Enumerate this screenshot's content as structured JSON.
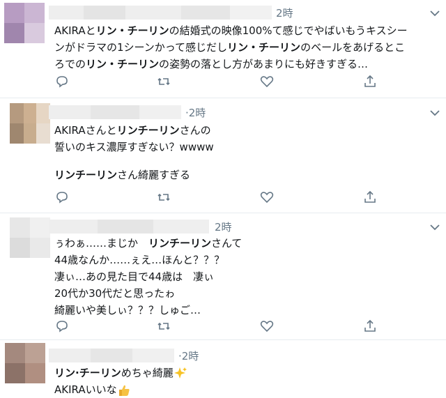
{
  "tweets": [
    {
      "time": "2時",
      "lines": [
        [
          {
            "t": "AKIRAと",
            "b": false
          },
          {
            "t": "リン・チーリン",
            "b": true
          },
          {
            "t": "の結婚式の映像100%て感じでやばいもうキスシー",
            "b": false
          }
        ],
        [
          {
            "t": "ンがドラマの1シーンかって感じだし",
            "b": false
          },
          {
            "t": "リン・チーリン",
            "b": true
          },
          {
            "t": "のベールをあげるとこ",
            "b": false
          }
        ],
        [
          {
            "t": "ろでの",
            "b": false
          },
          {
            "t": "リン・チーリン",
            "b": true
          },
          {
            "t": "の姿勢の落とし方があまりにも好きすぎる…",
            "b": false
          }
        ]
      ]
    },
    {
      "time": "·2時",
      "lines": [
        [
          {
            "t": "AKIRAさんと",
            "b": false
          },
          {
            "t": "リンチーリン",
            "b": true
          },
          {
            "t": "さんの",
            "b": false
          }
        ],
        [
          {
            "t": "誓いのキス濃厚すぎない？wwww",
            "b": false
          }
        ],
        [],
        [
          {
            "t": "リンチーリン",
            "b": true
          },
          {
            "t": "さん綺麗すぎる",
            "b": false
          }
        ]
      ]
    },
    {
      "time": "2時",
      "lines": [
        [
          {
            "t": "ぅわぁ……まじか　",
            "b": false
          },
          {
            "t": "リンチーリン",
            "b": true
          },
          {
            "t": "さんて",
            "b": false
          }
        ],
        [
          {
            "t": "44歳なんか……ぇえ…ほんと？？？",
            "b": false
          }
        ],
        [
          {
            "t": "凄ぃ…あの見た目で44歳は　凄ぃ",
            "b": false
          }
        ],
        [
          {
            "t": "20代か30代だと思ったゎ",
            "b": false
          }
        ],
        [
          {
            "t": "綺麗いや美しぃ？？？しゅご…",
            "b": false
          }
        ]
      ]
    },
    {
      "time": "·2時",
      "lines": [
        [
          {
            "t": "リン·チーリン",
            "b": true
          },
          {
            "t": "めちゃ綺麗",
            "b": false
          },
          {
            "t": "sparkles-emoji",
            "e": "sparkles"
          }
        ],
        [
          {
            "t": "AKIRAいいな",
            "b": false
          },
          {
            "t": "thumbs-up-emoji",
            "e": "thumb"
          }
        ]
      ]
    }
  ],
  "icons": {
    "reply": "reply-icon",
    "retweet": "retweet-icon",
    "like": "like-icon",
    "share": "share-icon",
    "caret": "chevron-down-icon"
  },
  "colors": {
    "text": "#14171a",
    "secondary": "#657786",
    "border": "#e6ecf0"
  }
}
